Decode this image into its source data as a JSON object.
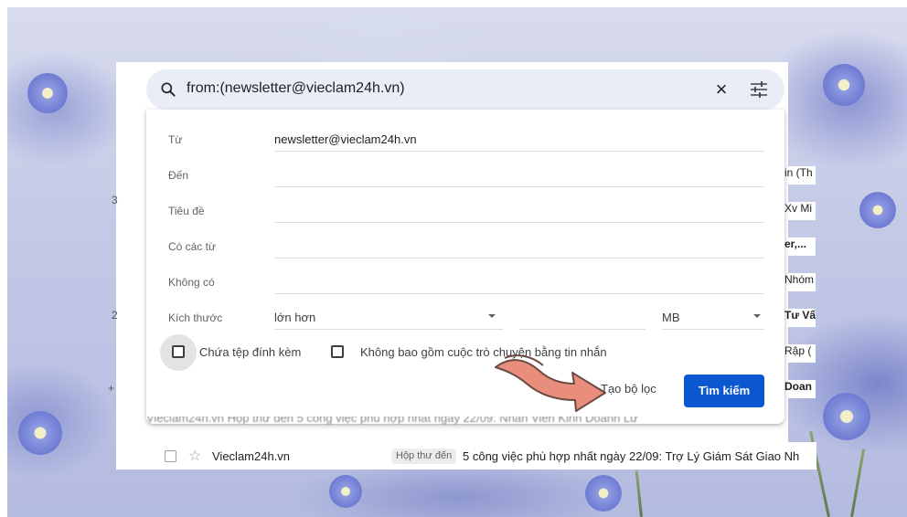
{
  "search": {
    "query": "from:(newsletter@vieclam24h.vn)"
  },
  "dialog": {
    "fields": [
      {
        "label": "Từ",
        "value": "newsletter@vieclam24h.vn"
      },
      {
        "label": "Đến",
        "value": ""
      },
      {
        "label": "Tiêu đề",
        "value": ""
      },
      {
        "label": "Có các từ",
        "value": ""
      },
      {
        "label": "Không có",
        "value": ""
      }
    ],
    "size": {
      "label": "Kích thước",
      "operator": "lớn hơn",
      "value": "",
      "unit": "MB"
    },
    "has_attachment_label": "Chứa tệp đính kèm",
    "exclude_chats_label": "Không bao gồm cuộc trò chuyện bằng tin nhắn",
    "create_filter_label": "Tạo bộ lọc",
    "search_button_label": "Tìm kiếm"
  },
  "left_edge_counts": [
    "3",
    "2",
    "+"
  ],
  "background_list": [
    {
      "text": "in (Th",
      "bold": false
    },
    {
      "text": "Xv Mi",
      "bold": false
    },
    {
      "text": "er,...",
      "bold": true
    },
    {
      "text": "Nhóm",
      "bold": false
    },
    {
      "text": "Tư Vấ",
      "bold": true
    },
    {
      "text": "Rập (",
      "bold": false
    },
    {
      "text": "Doan",
      "bold": true
    }
  ],
  "cut_row_text": "Vieclam24h.vn     Hộp thư đến   5 công việc phù hợp nhất ngày 22/09: Nhân Viên Kinh Doanh Lư",
  "email_row": {
    "sender": "Vieclam24h.vn",
    "label": "Hộp thư đến",
    "subject": "5 công việc phù hợp nhất ngày 22/09: Trợ Lý Giám Sát Giao Nh"
  },
  "colors": {
    "primary_button": "#0b57d0",
    "search_bar_bg": "#e9eef6",
    "arrow_fill": "#e98d7c"
  }
}
